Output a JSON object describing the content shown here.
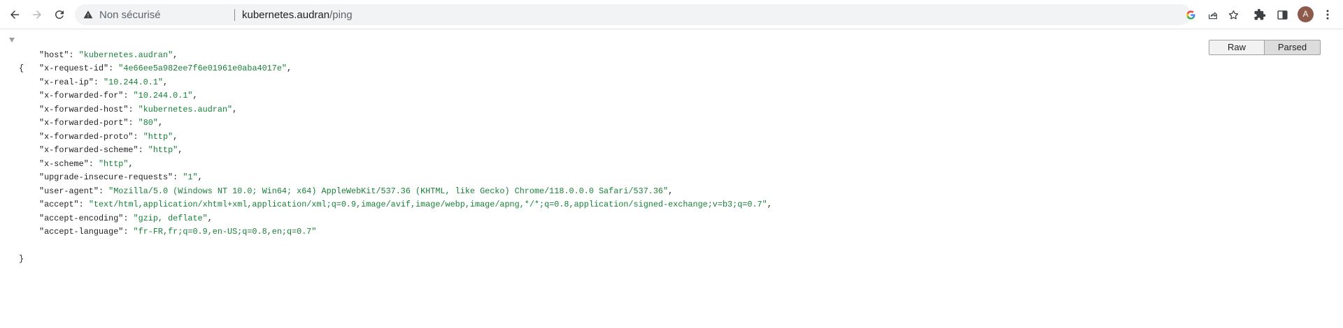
{
  "toolbar": {
    "security_label": "Non sécurisé",
    "url_host": "kubernetes.audran",
    "url_path": "/ping",
    "avatar_letter": "A",
    "icons": [
      "back-icon",
      "forward-icon",
      "reload-icon",
      "warning-icon",
      "google-icon",
      "share-icon",
      "bookmark-star-icon",
      "extensions-icon",
      "side-panel-icon",
      "more-icon"
    ]
  },
  "view_switch": {
    "raw_label": "Raw",
    "parsed_label": "Parsed"
  },
  "json": {
    "open_brace": "{",
    "close_brace": "}",
    "entries": [
      {
        "key": "\"host\"",
        "value": "\"kubernetes.audran\"",
        "sep": ","
      },
      {
        "key": "\"x-request-id\"",
        "value": "\"4e66ee5a982ee7f6e01961e0aba4017e\"",
        "sep": ","
      },
      {
        "key": "\"x-real-ip\"",
        "value": "\"10.244.0.1\"",
        "sep": ","
      },
      {
        "key": "\"x-forwarded-for\"",
        "value": "\"10.244.0.1\"",
        "sep": ","
      },
      {
        "key": "\"x-forwarded-host\"",
        "value": "\"kubernetes.audran\"",
        "sep": ","
      },
      {
        "key": "\"x-forwarded-port\"",
        "value": "\"80\"",
        "sep": ","
      },
      {
        "key": "\"x-forwarded-proto\"",
        "value": "\"http\"",
        "sep": ","
      },
      {
        "key": "\"x-forwarded-scheme\"",
        "value": "\"http\"",
        "sep": ","
      },
      {
        "key": "\"x-scheme\"",
        "value": "\"http\"",
        "sep": ","
      },
      {
        "key": "\"upgrade-insecure-requests\"",
        "value": "\"1\"",
        "sep": ","
      },
      {
        "key": "\"user-agent\"",
        "value": "\"Mozilla/5.0 (Windows NT 10.0; Win64; x64) AppleWebKit/537.36 (KHTML, like Gecko) Chrome/118.0.0.0 Safari/537.36\"",
        "sep": ","
      },
      {
        "key": "\"accept\"",
        "value": "\"text/html,application/xhtml+xml,application/xml;q=0.9,image/avif,image/webp,image/apng,*/*;q=0.8,application/signed-exchange;v=b3;q=0.7\"",
        "sep": ","
      },
      {
        "key": "\"accept-encoding\"",
        "value": "\"gzip, deflate\"",
        "sep": ","
      },
      {
        "key": "\"accept-language\"",
        "value": "\"fr-FR,fr;q=0.9,en-US;q=0.8,en;q=0.7\"",
        "sep": ""
      }
    ]
  },
  "colors": {
    "json_string": "#188038",
    "json_key": "#1f1f1f",
    "omnibox_bg": "#f1f3f4"
  }
}
